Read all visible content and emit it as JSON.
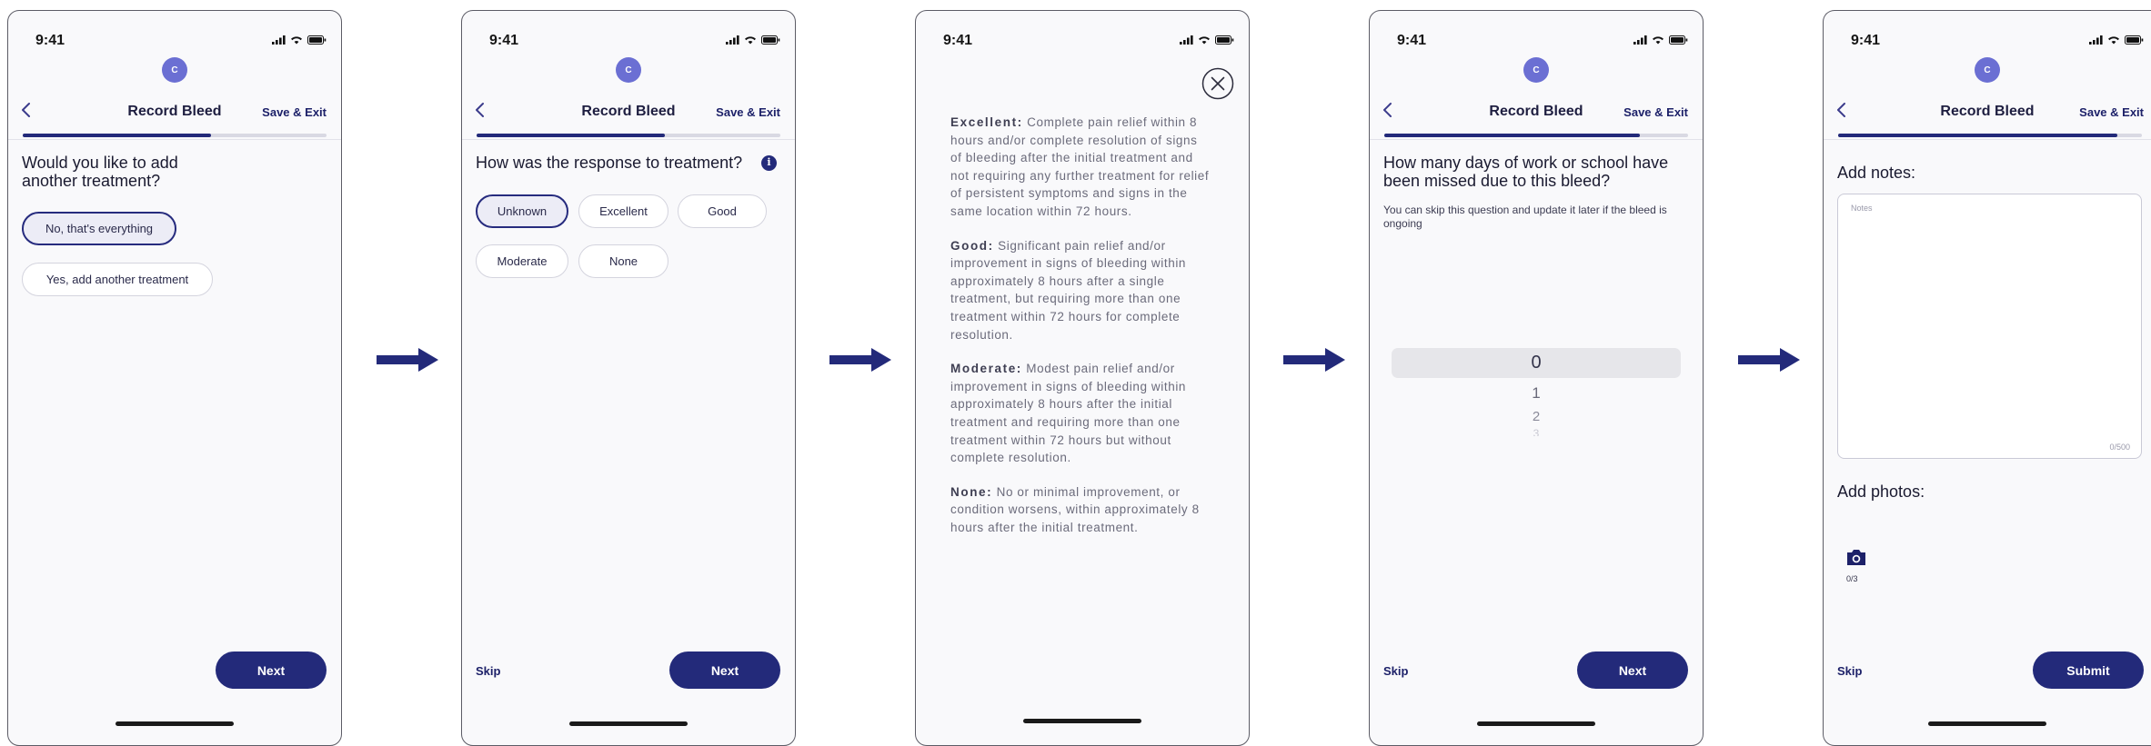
{
  "status": {
    "time": "9:41"
  },
  "header": {
    "avatar_initial": "C",
    "title": "Record Bleed",
    "save_exit": "Save & Exit"
  },
  "colors": {
    "brand_navy": "#232a7a",
    "avatar": "#6b6fd3",
    "progress_track": "#d9d9e3"
  },
  "screens": {
    "add_treatment": {
      "progress": 0.62,
      "question": "Would you like to add another treatment?",
      "options": [
        {
          "label": "No, that's everything",
          "selected": true
        },
        {
          "label": "Yes, add another treatment",
          "selected": false
        }
      ],
      "next_label": "Next"
    },
    "response": {
      "progress": 0.62,
      "question": "How was the response to treatment?",
      "info_icon": "info-icon",
      "options": [
        {
          "label": "Unknown",
          "selected": true
        },
        {
          "label": "Excellent",
          "selected": false
        },
        {
          "label": "Good",
          "selected": false
        },
        {
          "label": "Moderate",
          "selected": false
        },
        {
          "label": "None",
          "selected": false
        }
      ],
      "skip_label": "Skip",
      "next_label": "Next"
    },
    "definitions": {
      "close_icon": "close-icon",
      "items": [
        {
          "term": "Excellent:",
          "text": "Complete pain relief within 8 hours and/or complete resolution of signs of bleeding after the initial treatment and not requiring any further treatment for relief of persistent symptoms and signs in the same location within 72 hours."
        },
        {
          "term": "Good:",
          "text": "Significant pain relief and/or improvement in signs of bleeding within approximately 8 hours after a single treatment, but requiring more than one treatment within 72 hours for complete resolution."
        },
        {
          "term": "Moderate:",
          "text": "Modest pain relief and/or improvement in signs of bleeding within approximately 8 hours after the initial treatment and requiring more than one treatment within 72 hours but without complete resolution."
        },
        {
          "term": "None:",
          "text": "No or minimal improvement, or condition worsens, within approximately 8 hours after the initial treatment."
        }
      ]
    },
    "missed_days": {
      "progress": 0.84,
      "question": "How many days of work or school have been missed due to this bleed?",
      "note": "You can skip this question and update it later if the bleed is ongoing",
      "picker_values": [
        "0",
        "1",
        "2",
        "3"
      ],
      "picker_selected": "0",
      "skip_label": "Skip",
      "next_label": "Next"
    },
    "notes": {
      "progress": 0.92,
      "notes_label": "Add notes:",
      "notes_placeholder": "Notes",
      "notes_counter": "0/500",
      "photos_label": "Add photos:",
      "photo_count": "0/3",
      "camera_icon": "camera-icon",
      "skip_label": "Skip",
      "submit_label": "Submit"
    }
  }
}
